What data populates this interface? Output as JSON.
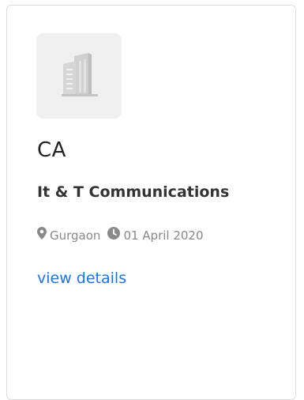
{
  "card": {
    "logo_icon": "building-icon",
    "title": "CA",
    "company": "It & T Communications",
    "location": "Gurgaon",
    "location_icon": "map-marker-icon",
    "date": "01 April 2020",
    "date_icon": "clock-icon",
    "link_text": "view details"
  },
  "colors": {
    "link": "#1a73e8",
    "muted": "#888888",
    "logo_bg": "#f0f0f0"
  }
}
